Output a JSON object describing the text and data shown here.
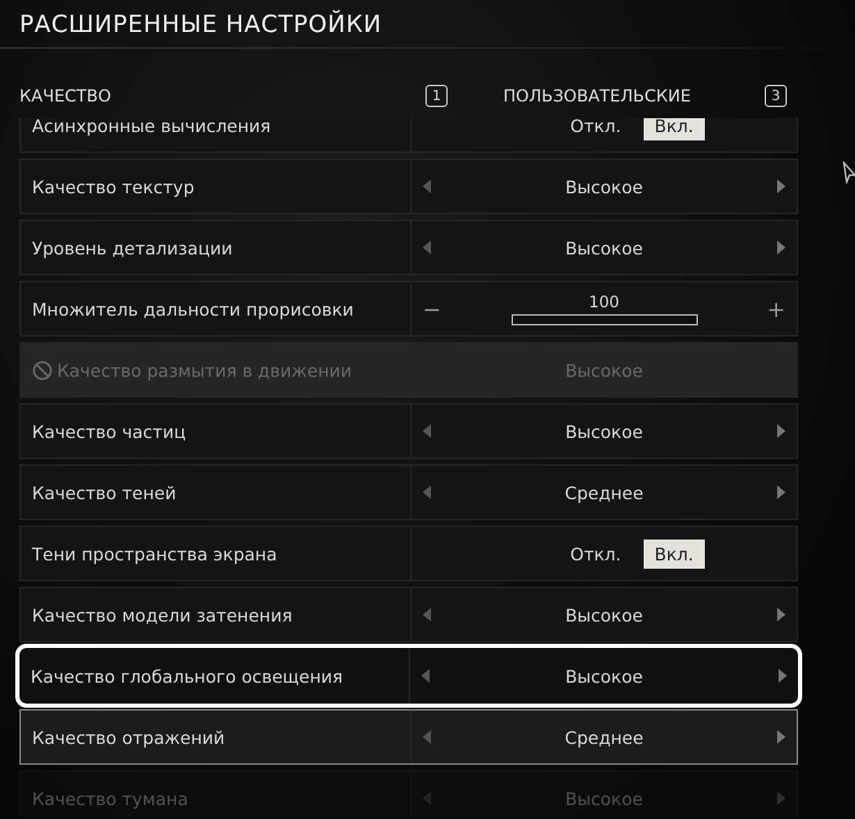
{
  "title": "РАСШИРЕННЫЕ НАСТРОЙКИ",
  "preset": {
    "label": "КАЧЕСТВО",
    "left_key": "1",
    "value": "ПОЛЬЗОВАТЕЛЬСКИЕ",
    "right_key": "3"
  },
  "settings": [
    {
      "kind": "toggle",
      "label": "Асинхронные вычисления",
      "options": [
        {
          "label": "Откл.",
          "selected": false
        },
        {
          "label": "Вкл.",
          "selected": true
        }
      ],
      "focused": false,
      "hovered": false
    },
    {
      "kind": "select",
      "label": "Качество текстур",
      "value": "Высокое",
      "focused": false,
      "hovered": false
    },
    {
      "kind": "select",
      "label": "Уровень детализации",
      "value": "Высокое",
      "focused": false,
      "hovered": false
    },
    {
      "kind": "slider",
      "label": "Множитель дальности прорисовки",
      "minus": "−",
      "plus": "+",
      "value": "100",
      "focused": false,
      "hovered": false
    },
    {
      "kind": "disabled",
      "label": "Качество размытия в движении",
      "value": "Высокое",
      "focused": false,
      "hovered": false
    },
    {
      "kind": "select",
      "label": "Качество частиц",
      "value": "Высокое",
      "focused": false,
      "hovered": false
    },
    {
      "kind": "select",
      "label": "Качество теней",
      "value": "Среднее",
      "focused": false,
      "hovered": false
    },
    {
      "kind": "toggle",
      "label": "Тени пространства экрана",
      "options": [
        {
          "label": "Откл.",
          "selected": false
        },
        {
          "label": "Вкл.",
          "selected": true
        }
      ],
      "focused": false,
      "hovered": false
    },
    {
      "kind": "select",
      "label": "Качество модели затенения",
      "value": "Высокое",
      "focused": false,
      "hovered": false
    },
    {
      "kind": "select",
      "label": "Качество глобального освещения",
      "value": "Высокое",
      "focused": true,
      "hovered": false
    },
    {
      "kind": "select",
      "label": "Качество отражений",
      "value": "Среднее",
      "focused": false,
      "hovered": true
    },
    {
      "kind": "select",
      "label": "Качество тумана",
      "value": "Высокое",
      "focused": false,
      "hovered": false
    }
  ]
}
